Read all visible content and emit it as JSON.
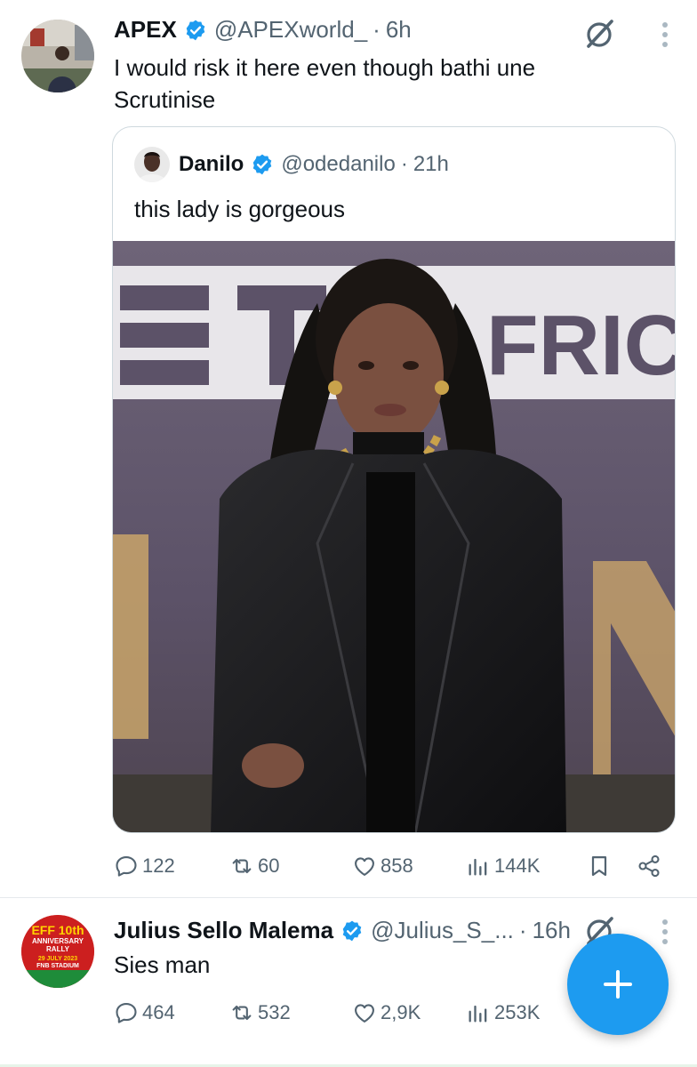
{
  "colors": {
    "accent": "#1d9bf0",
    "text": "#0f1419",
    "muted": "#536471",
    "border": "#cfd9de"
  },
  "tweets": [
    {
      "author_name": "APEX",
      "handle": "@APEXworld_",
      "dot": "·",
      "time": "6h",
      "text_line1": "I would risk it here even though bathi une",
      "text_line2": "Scrutinise",
      "quote": {
        "author_name": "Danilo",
        "handle": "@odedanilo",
        "dot": "·",
        "time": "21h",
        "text": "this lady is gorgeous",
        "media_backdrop_text": "FRICA"
      },
      "actions": {
        "replies": "122",
        "reposts": "60",
        "likes": "858",
        "views": "144K"
      }
    },
    {
      "author_name": "Julius Sello Malema",
      "handle": "@Julius_S_...",
      "dot": "·",
      "time": "16h",
      "text": "Sies man",
      "avatar_text": {
        "line1": "EFF 10th",
        "line2": "ANNIVERSARY",
        "line3": "RALLY",
        "line4": "29 JULY 2023",
        "line5": "FNB STADIUM"
      },
      "actions": {
        "replies": "464",
        "reposts": "532",
        "likes": "2,9K",
        "views": "253K"
      }
    }
  ],
  "icons": [
    "verified-badge-icon",
    "grok-icon",
    "more-icon",
    "reply-icon",
    "repost-icon",
    "like-icon",
    "views-icon",
    "bookmark-icon",
    "share-icon",
    "compose-plus-icon"
  ]
}
